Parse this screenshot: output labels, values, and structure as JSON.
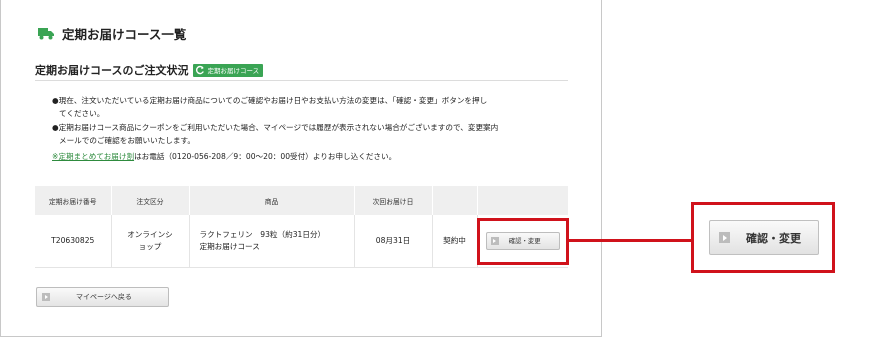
{
  "header": {
    "title": "定期お届けコース一覧",
    "icon": "truck-icon",
    "accent_color": "#3aa454"
  },
  "subheader": {
    "title": "定期お届けコースのご注文状況",
    "badge_label": "定期お届けコース",
    "badge_icon": "refresh-icon"
  },
  "notes": {
    "line1": "●現在、注文いただいている定期お届け商品についてのご確認やお届け日やお支払い方法の変更は、「確認・変更」ボタンを押し",
    "line1b": "てください。",
    "line2": "●定期お届けコース商品にクーポンをご利用いただいた場合、マイページでは履歴が表示されない場合がございますので、変更案内",
    "line2b": "メールでのご確認をお願いいたします。",
    "link_text": "※定期まとめてお届け割",
    "phone_text": "はお電話（0120-056-208／9：00〜20：00受付）よりお申し込ください。"
  },
  "table": {
    "headers": [
      "定期お届け番号",
      "注文区分",
      "商品",
      "次回お届け日",
      "",
      ""
    ],
    "row": {
      "order_no": "T20630825",
      "type_line1": "オンラインシ",
      "type_line2": "ョップ",
      "product_line1": "ラクトフェリン　93粒（約31日分）",
      "product_line2": "定期お届けコース",
      "next_date": "08月31日",
      "status": "契約中",
      "action_label": "確認・変更"
    }
  },
  "callout": {
    "button_label": "確認・変更",
    "highlight_color": "#d0121b"
  },
  "footer": {
    "back_label": "マイページへ戻る"
  }
}
